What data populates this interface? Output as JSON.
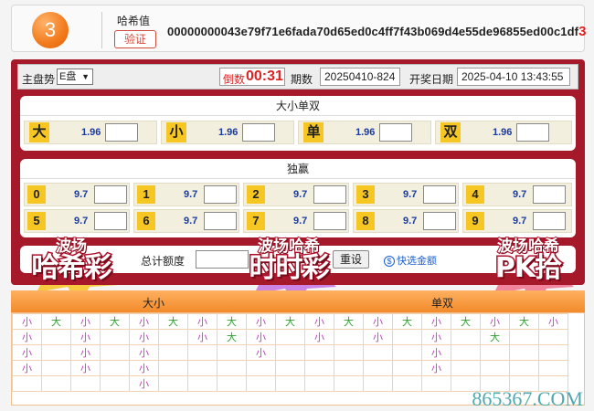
{
  "result": {
    "number": "3",
    "hash_label": "哈希值",
    "verify_label": "验证",
    "hash_main": "00000000043e79f71e6fada70d65ed0c4ff7f43b069d4e55de96855ed00c1df",
    "hash_last": "3"
  },
  "toolbar": {
    "market_label": "主盘势",
    "market_value": "E盘",
    "countdown_label": "倒数",
    "countdown_value": "00:31",
    "period_label": "期数",
    "period_value": "20250410-824",
    "draw_date_label": "开奖日期",
    "draw_date_value": "2025-04-10 13:43:55"
  },
  "size_parity": {
    "title": "大小单双",
    "items": [
      {
        "tag": "大",
        "odds": "1.96"
      },
      {
        "tag": "小",
        "odds": "1.96"
      },
      {
        "tag": "单",
        "odds": "1.96"
      },
      {
        "tag": "双",
        "odds": "1.96"
      }
    ]
  },
  "single": {
    "title": "独赢",
    "items": [
      {
        "tag": "0",
        "odds": "9.7"
      },
      {
        "tag": "1",
        "odds": "9.7"
      },
      {
        "tag": "2",
        "odds": "9.7"
      },
      {
        "tag": "3",
        "odds": "9.7"
      },
      {
        "tag": "4",
        "odds": "9.7"
      },
      {
        "tag": "5",
        "odds": "9.7"
      },
      {
        "tag": "6",
        "odds": "9.7"
      },
      {
        "tag": "7",
        "odds": "9.7"
      },
      {
        "tag": "8",
        "odds": "9.7"
      },
      {
        "tag": "9",
        "odds": "9.7"
      }
    ]
  },
  "bottom": {
    "total_label": "总计额度",
    "reset_label": "重设",
    "quick_label": "快选金额",
    "quick_icon": "$"
  },
  "promos": [
    {
      "line1": "波场",
      "line2": "哈希彩"
    },
    {
      "line1": "波场哈希",
      "line2": "时时彩"
    },
    {
      "line1": "波场哈希",
      "line2": "PK拾"
    }
  ],
  "trend": {
    "head_size": "大小",
    "head_parity": "单双",
    "rows": [
      [
        "小",
        "大",
        "小",
        "大",
        "小",
        "大",
        "小",
        "大",
        "小",
        "大",
        "小",
        "大",
        "小",
        "大",
        "小",
        "大",
        "小",
        "大",
        "小"
      ],
      [
        "小",
        "",
        "小",
        "",
        "小",
        "",
        "小",
        "大",
        "小",
        "",
        "小",
        "",
        "小",
        "",
        "小",
        "",
        "大",
        "",
        ""
      ],
      [
        "小",
        "",
        "小",
        "",
        "小",
        "",
        "",
        "",
        "小",
        "",
        "",
        "",
        "",
        "",
        "小",
        "",
        "",
        "",
        ""
      ],
      [
        "小",
        "",
        "小",
        "",
        "小",
        "",
        "",
        "",
        "",
        "",
        "",
        "",
        "",
        "",
        "小",
        "",
        "",
        "",
        ""
      ],
      [
        "",
        "",
        "",
        "",
        "小",
        "",
        "",
        "",
        "",
        "",
        "",
        "",
        "",
        "",
        "",
        "",
        "",
        "",
        ""
      ]
    ]
  },
  "watermark": "865367.COM"
}
